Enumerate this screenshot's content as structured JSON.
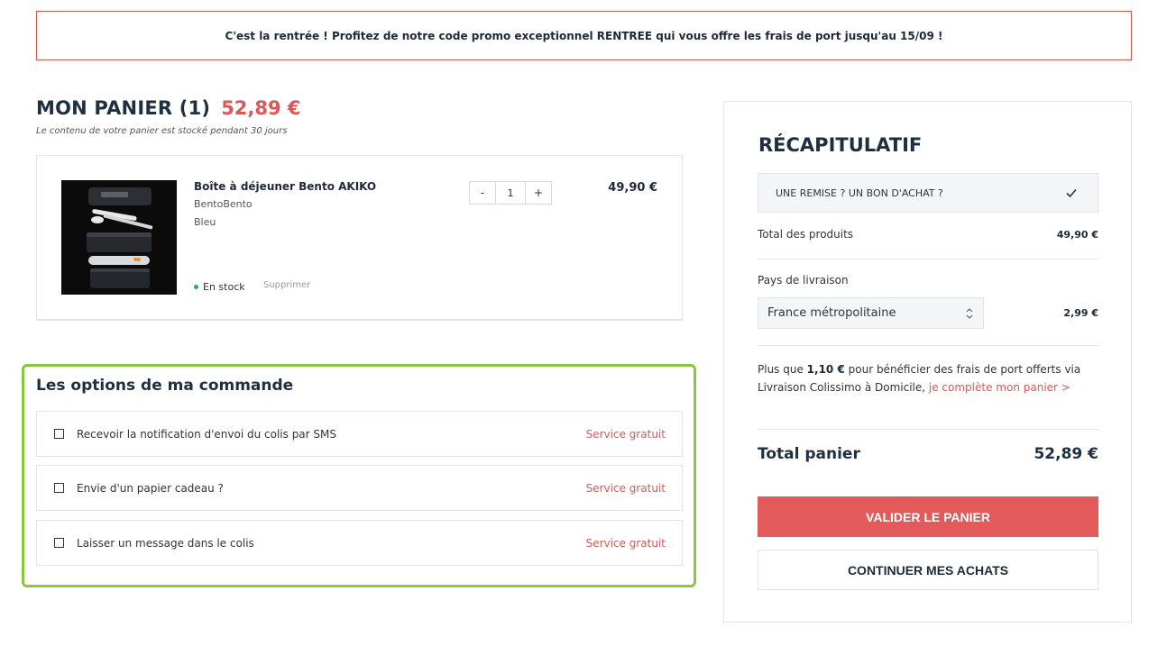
{
  "promo": {
    "text": "C'est la rentrée ! Profitez de notre code promo exceptionnel RENTREE qui vous offre les frais de port jusqu'au 15/09 !"
  },
  "cart": {
    "title": "MON PANIER (1)",
    "total": "52,89 €",
    "subtitle": "Le contenu de votre panier est stocké pendant 30 jours",
    "item": {
      "name": "Boîte à déjeuner Bento AKIKO",
      "brand": "BentoBento",
      "color": "Bleu",
      "stock": "En stock",
      "remove": "Supprimer",
      "qty_minus": "-",
      "qty": "1",
      "qty_plus": "+",
      "price": "49,90 €"
    }
  },
  "options": {
    "title": "Les options de ma commande",
    "items": [
      {
        "label": "Recevoir la notification d'envoi du colis par SMS",
        "price": "Service gratuit"
      },
      {
        "label": "Envie d'un papier cadeau ?",
        "price": "Service gratuit"
      },
      {
        "label": "Laisser un message dans le colis",
        "price": "Service gratuit"
      }
    ]
  },
  "summary": {
    "title": "RÉCAPITULATIF",
    "discount_label": "UNE REMISE ? UN BON D'ACHAT ?",
    "products_label": "Total des produits",
    "products_value": "49,90 €",
    "country_label": "Pays de livraison",
    "country_value": "France métropolitaine",
    "shipping_value": "2,99 €",
    "free_shipping": {
      "prefix": "Plus que ",
      "amount": "1,10 €",
      "middle": " pour bénéficier des frais de port offerts via Livraison Colissimo à Domicile, ",
      "link": "je complète mon panier >"
    },
    "total_label": "Total panier",
    "total_value": "52,89 €",
    "validate_button": "VALIDER LE PANIER",
    "continue_button": "CONTINUER MES ACHATS"
  },
  "colors": {
    "accent_red": "#e35a5a",
    "highlight_green": "#8cc63f",
    "stock_green": "#27ae60"
  }
}
